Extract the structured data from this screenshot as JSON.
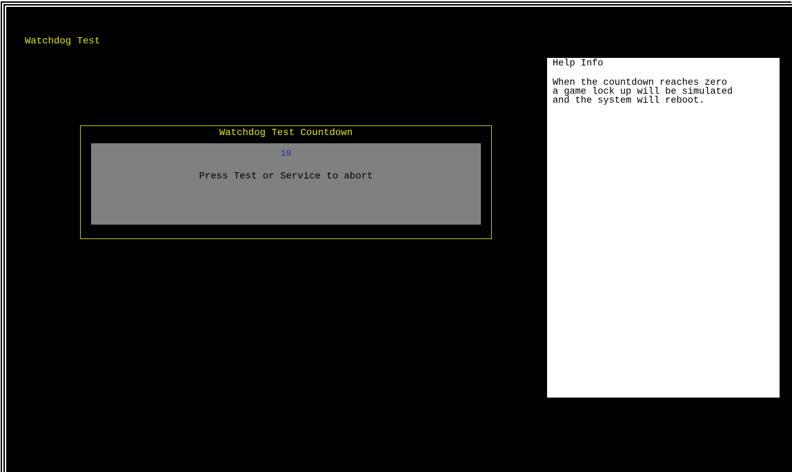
{
  "screen": {
    "title": "Watchdog Test"
  },
  "countdown": {
    "title": "Watchdog Test Countdown",
    "value": "19",
    "message": "Press Test or Service to abort"
  },
  "help": {
    "title": "Help Info",
    "lines": [
      "When the countdown reaches zero",
      "a game lock up will be simulated",
      "and the system will reboot."
    ]
  },
  "colors": {
    "background": "#000000",
    "title_text": "#e6e600",
    "box_border": "#c8c800",
    "panel": "#808080",
    "countdown_value": "#2a2ab8",
    "help_background": "#ffffff"
  }
}
